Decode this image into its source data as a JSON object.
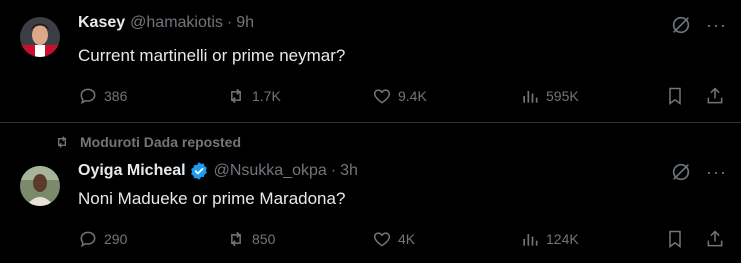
{
  "tweets": [
    {
      "author": {
        "name": "Kasey",
        "handle": "@hamakiotis",
        "time": "9h"
      },
      "text": "Current martinelli or prime neymar?",
      "stats": {
        "replies": "386",
        "reposts": "1.7K",
        "likes": "9.4K",
        "views": "595K"
      }
    },
    {
      "repost_label": "Moduroti Dada reposted",
      "author": {
        "name": "Oyiga Micheal",
        "handle": "@Nsukka_okpa",
        "time": "3h",
        "verified": true
      },
      "text": "Noni Madueke or prime Maradona?",
      "stats": {
        "replies": "290",
        "reposts": "850",
        "likes": "4K",
        "views": "124K"
      }
    }
  ],
  "separator": "·",
  "more_glyph": "···",
  "icons": [
    "grok-icon",
    "more-icon",
    "reply-icon",
    "repost-icon",
    "like-icon",
    "views-icon",
    "bookmark-icon",
    "share-icon",
    "verified-badge-icon"
  ],
  "colors": {
    "background": "#000000",
    "text": "#e7e9ea",
    "muted": "#71767b",
    "verified": "#1d9bf0",
    "divider": "#2f3336"
  }
}
